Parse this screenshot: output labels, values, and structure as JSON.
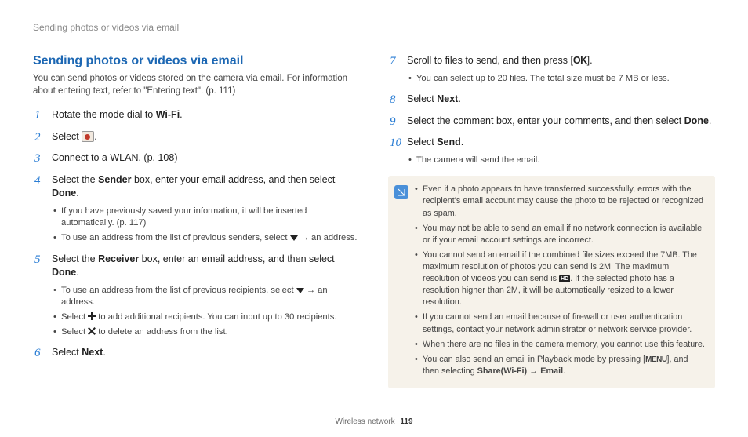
{
  "header": {
    "title": "Sending photos or videos via email"
  },
  "section": {
    "title": "Sending photos or videos via email",
    "intro": "You can send photos or videos stored on the camera via email. For information about entering text, refer to \"Entering text\". (p. 111)"
  },
  "steps_left": {
    "s1_a": "Rotate the mode dial to ",
    "s1_wifi": "Wi-Fi",
    "s1_b": ".",
    "s2_a": "Select ",
    "s2_b": ".",
    "s3": "Connect to a WLAN. (p. 108)",
    "s4_a": "Select the ",
    "s4_sender": "Sender",
    "s4_b": " box, enter your email address, and then select ",
    "s4_done": "Done",
    "s4_c": ".",
    "s4_sub1": "If you have previously saved your information, it will be inserted automatically. (p. 117)",
    "s4_sub2_a": "To use an address from the list of previous senders, select ",
    "s4_sub2_b": " → an address.",
    "s5_a": "Select the ",
    "s5_receiver": "Receiver",
    "s5_b": " box, enter an email address, and then select ",
    "s5_done": "Done",
    "s5_c": ".",
    "s5_sub1_a": "To use an address from the list of previous recipients, select ",
    "s5_sub1_b": " → an address.",
    "s5_sub2_a": "Select ",
    "s5_sub2_b": " to add additional recipients. You can input up to 30 recipients.",
    "s5_sub3_a": "Select ",
    "s5_sub3_b": " to delete an address from the list.",
    "s6_a": "Select ",
    "s6_next": "Next",
    "s6_b": "."
  },
  "steps_right": {
    "s7_a": "Scroll to files to send, and then press [",
    "s7_ok": "OK",
    "s7_b": "].",
    "s7_sub1": "You can select up to 20 files. The total size must be 7 MB or less.",
    "s8_a": "Select ",
    "s8_next": "Next",
    "s8_b": ".",
    "s9_a": "Select the comment box, enter your comments, and then select ",
    "s9_done": "Done",
    "s9_b": ".",
    "s10_a": "Select ",
    "s10_send": "Send",
    "s10_b": ".",
    "s10_sub1": "The camera will send the email."
  },
  "notes": {
    "n1": "Even if a photo appears to have transferred successfully, errors with the recipient's email account may cause the photo to be rejected or recognized as spam.",
    "n2": "You may not be able to send an email if no network connection is available or if your email account settings are incorrect.",
    "n3_a": "You cannot send an email if the combined file sizes exceed the 7MB. The maximum resolution of photos you can send is 2M. The maximum resolution of videos you can send is ",
    "n3_b": ". If the selected photo has a resolution higher than 2M, it will be automatically resized to a lower resolution.",
    "n4": "If you cannot send an email because of firewall or user authentication settings, contact your network administrator or network service provider.",
    "n5": "When there are no files in the camera memory, you cannot use this feature.",
    "n6_a": "You can also send an email in Playback mode by pressing [",
    "n6_menu": "MENU",
    "n6_b": "], and then selecting ",
    "n6_share": "Share(Wi-Fi)",
    "n6_arrow": " → ",
    "n6_email": "Email",
    "n6_c": "."
  },
  "footer": {
    "section": "Wireless network",
    "page": "119"
  }
}
